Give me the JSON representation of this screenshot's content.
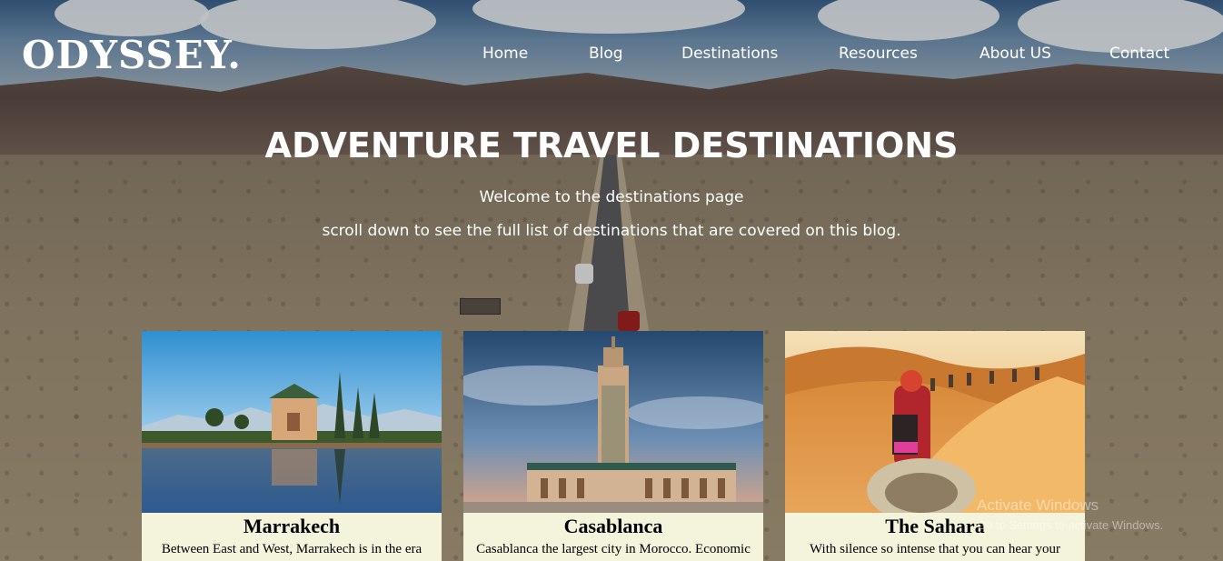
{
  "site": {
    "logo": "ODYSSEY."
  },
  "nav": {
    "items": [
      "Home",
      "Blog",
      "Destinations",
      "Resources",
      "About US",
      "Contact"
    ]
  },
  "hero": {
    "title": "ADVENTURE TRAVEL DESTINATIONS",
    "welcome": "Welcome to the destinations page",
    "subtitle": "scroll down to see the full list of destinations that are covered on this blog."
  },
  "cards": [
    {
      "title": "Marrakech",
      "text": "Between East and West, Marrakech is in the era"
    },
    {
      "title": "Casablanca",
      "text": "Casablanca the largest city in Morocco. Economic"
    },
    {
      "title": "The Sahara",
      "text": "With silence so intense that you can hear your"
    }
  ],
  "watermark": {
    "title": "Activate Windows",
    "subtitle": "Go to Settings to activate Windows."
  },
  "colors": {
    "card_body": "#f4f3dc",
    "nav_text": "#ffffff"
  }
}
